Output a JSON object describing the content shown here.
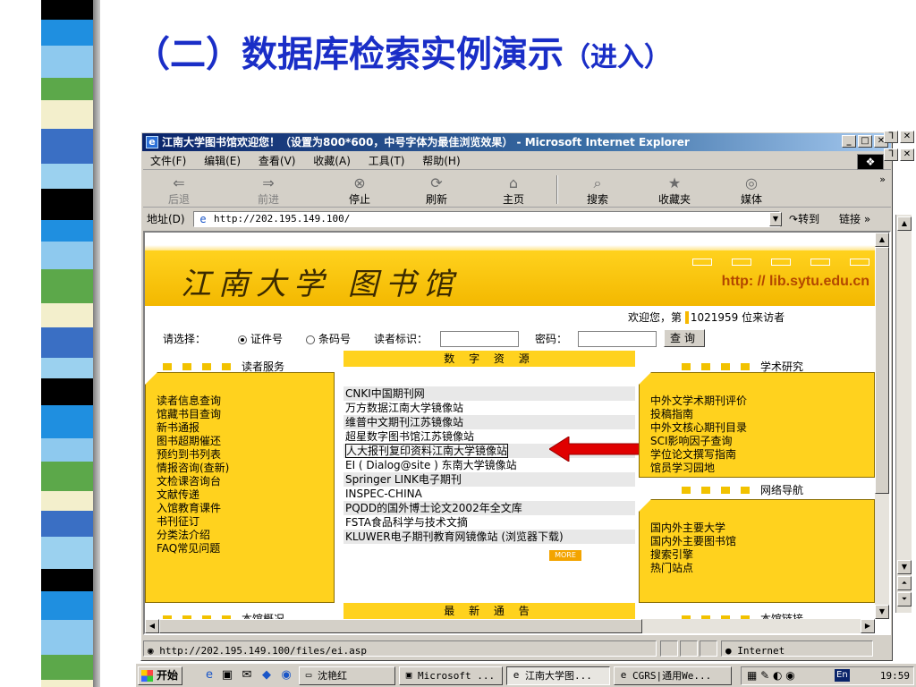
{
  "slide": {
    "title_main": "（二）数据库检索实例演示",
    "title_sub": "（进入）"
  },
  "ie": {
    "window_title": "江南大学图书馆欢迎您！（设置为800*600，中号字体为最佳浏览效果） - Microsoft Internet Explorer",
    "menu": [
      "文件(F)",
      "编辑(E)",
      "查看(V)",
      "收藏(A)",
      "工具(T)",
      "帮助(H)"
    ],
    "toolbar": {
      "back": "后退",
      "forward": "前进",
      "stop": "停止",
      "refresh": "刷新",
      "home": "主页",
      "search": "搜索",
      "favorites": "收藏夹",
      "media": "媒体"
    },
    "address": {
      "label": "地址(D)",
      "value": "http://202.195.149.100/",
      "go": "转到",
      "links": "链接 »"
    },
    "status": {
      "url": "http://202.195.149.100/files/ei.asp",
      "zone": "Internet"
    }
  },
  "site": {
    "logo_text": "江南大学 图书馆",
    "url_banner": "http: // lib.sytu.edu.cn",
    "welcome": {
      "prefix": "欢迎您，第",
      "count": "1021959",
      "suffix": "位来访者"
    },
    "login": {
      "choose_label": "请选择：",
      "option_1": "证件号",
      "option_2": "条码号",
      "reader_id_label": "读者标识：",
      "password_label": "密码：",
      "query_button": "查询"
    },
    "sections": {
      "reader_service": "读者服务",
      "digital_resources": "数 字 资 源",
      "academic_research": "学术研究",
      "web_navigation": "网络导航",
      "news": "最 新 通 告",
      "library_overview": "本馆概况",
      "library_links": "本馆链接"
    },
    "reader_service_items": [
      "读者信息查询",
      "馆藏书目查询",
      "新书通报",
      "图书超期催还",
      "预约到书列表",
      "情报咨询(查新)",
      "文检课咨询台",
      "文献传递",
      "入馆教育课件",
      "书刊征订",
      "分类法介绍",
      "FAQ常见问题"
    ],
    "digital_resource_items": [
      "CNKI中国期刊网",
      "万方数据江南大学镜像站",
      "维普中文期刊江苏镜像站",
      "超星数字图书馆江苏镜像站",
      "人大报刊复印资料江南大学镜像站",
      "EI ( Dialog@site ) 东南大学镜像站",
      "Springer LINK电子期刊",
      "INSPEC-CHINA",
      "PQDD的国外博士论文2002年全文库",
      "FSTA食品科学与技术文摘",
      "KLUWER电子期刊教育网镜像站 (浏览器下载)"
    ],
    "more_button": "MORE",
    "academic_items": [
      "中外文学术期刊评价",
      "投稿指南",
      "中外文核心期刊目录",
      "SCI影响因子查询",
      "学位论文撰写指南",
      "馆员学习园地"
    ],
    "web_nav_items": [
      "国内外主要大学",
      "国内外主要图书馆",
      "搜索引擎",
      "热门站点"
    ]
  },
  "taskbar": {
    "start": "开始",
    "tasks": [
      "沈艳红",
      "Microsoft ...",
      "江南大学图...",
      "CGRS|通用We..."
    ],
    "ime": "En",
    "clock": "19:59"
  },
  "colors": {
    "title_blue": "#1a2ec7",
    "site_yellow": "#ffd21e",
    "arrow_red": "#e00000"
  }
}
